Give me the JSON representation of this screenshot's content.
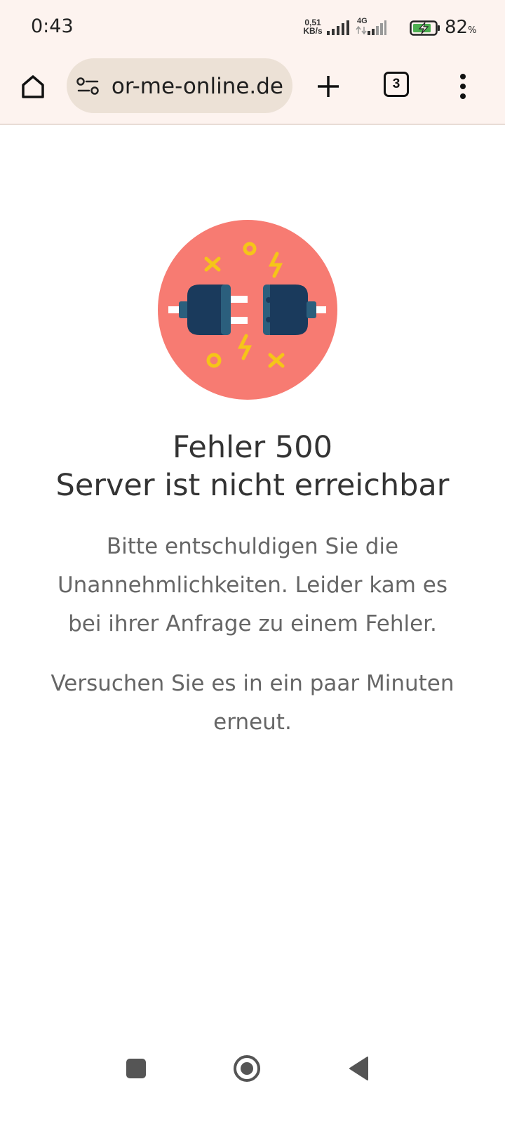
{
  "status_bar": {
    "time": "0:43",
    "net_speed_value": "0,51",
    "net_speed_unit": "KB/s",
    "network_type": "4G",
    "battery_percent": "82",
    "battery_percent_sign": "%"
  },
  "toolbar": {
    "url": "or-me-online.de",
    "tab_count": "3"
  },
  "error": {
    "code_line": "Fehler 500",
    "title_line": "Server ist nicht erreichbar",
    "message": "Bitte entschuldigen Sie die Unannehmlichkeiten. Leider kam es bei ihrer Anfrage zu einem Fehler.",
    "retry": "Versuchen Sie es in ein paar Minuten erneut."
  },
  "colors": {
    "hero_circle": "#f77b72",
    "plug_body": "#1a3a5c",
    "plug_accent": "#2b5f7d",
    "spark_yellow": "#f5c518"
  }
}
